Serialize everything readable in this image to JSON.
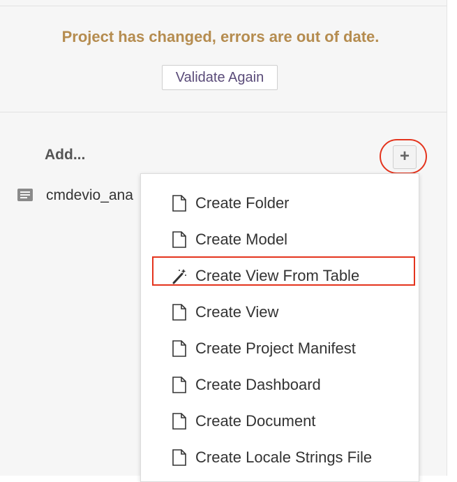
{
  "warning": {
    "message": "Project has changed, errors are out of date.",
    "validate_label": "Validate Again"
  },
  "add": {
    "label": "Add...",
    "plus_label": "+",
    "plus_icon": "plus-icon"
  },
  "files": [
    {
      "name": "cmdevio_ana",
      "icon": "document-list-icon"
    }
  ],
  "menu": {
    "items": [
      {
        "label": "Create Folder",
        "icon": "file-icon"
      },
      {
        "label": "Create Model",
        "icon": "file-icon"
      },
      {
        "label": "Create View From Table",
        "icon": "magic-wand-icon"
      },
      {
        "label": "Create View",
        "icon": "file-icon"
      },
      {
        "label": "Create Project Manifest",
        "icon": "file-icon"
      },
      {
        "label": "Create Dashboard",
        "icon": "file-icon"
      },
      {
        "label": "Create Document",
        "icon": "file-icon"
      },
      {
        "label": "Create Locale Strings File",
        "icon": "file-icon"
      }
    ]
  },
  "colors": {
    "warning_text": "#b58c4f",
    "validate_text": "#5a4b79",
    "highlight": "#e4341d"
  }
}
